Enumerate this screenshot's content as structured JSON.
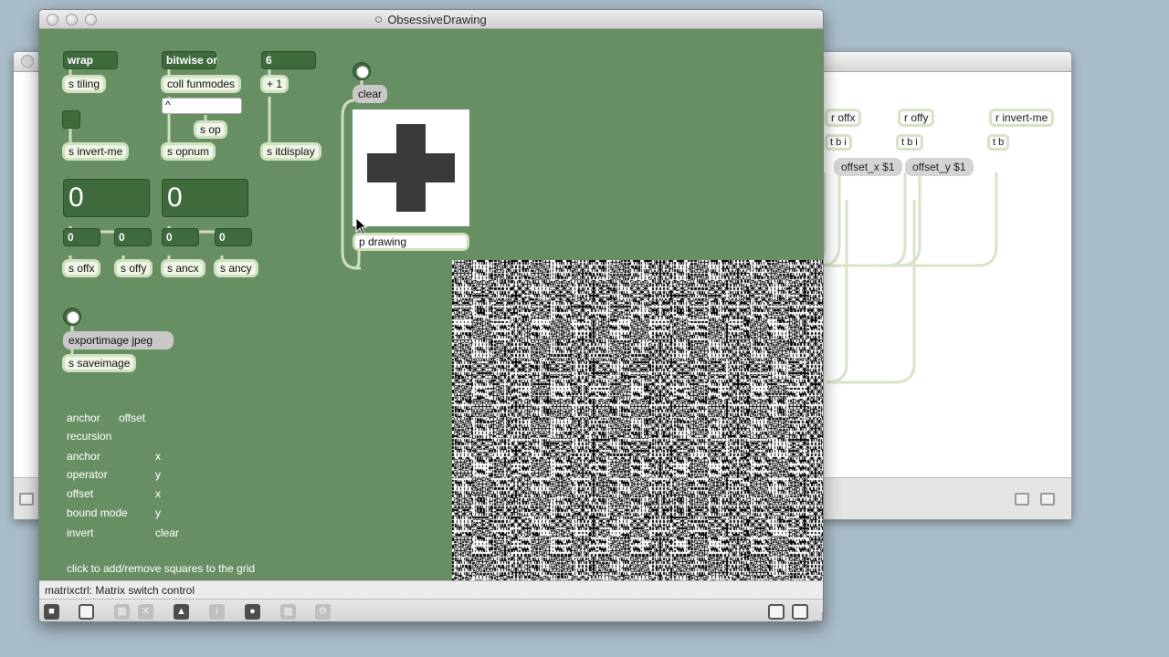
{
  "background_window": {
    "objects": [
      "r offx",
      "r offy",
      "r invert-me"
    ],
    "triggers": [
      "t b i",
      "t b i",
      "t b"
    ],
    "messages": [
      "offset_x $1",
      "offset_y $1"
    ]
  },
  "window": {
    "title": "ObsessiveDrawing"
  },
  "patch": {
    "wrap_menu": "wrap",
    "s_tiling": "s tiling",
    "s_invert_me": "s invert-me",
    "bitwise_menu": "bitwise or",
    "coll_funmodes": "coll funmodes",
    "op_text": "^",
    "s_op": "s op",
    "s_opnum": "s opnum",
    "num_six": "6",
    "plus_one": "+ 1",
    "s_itdisplay": "s itdisplay",
    "clear_msg": "clear",
    "p_drawing": "p drawing",
    "big_num_1": "0",
    "big_num_2": "0",
    "num_a": "0",
    "num_b": "0",
    "num_c": "0",
    "num_d": "0",
    "s_offx": "s offx",
    "s_offy": "s offy",
    "s_ancx": "s ancx",
    "s_ancy": "s ancy",
    "export_msg": "exportimage jpeg",
    "s_saveimage": "s saveimage",
    "comments": {
      "anchor": "anchor",
      "offset": "offset",
      "recursion": "recursion",
      "anchor2": "anchor",
      "x1": "x",
      "operator": "operator",
      "y1": "y",
      "offset2": "offset",
      "x2": "x",
      "bound_mode": "bound mode",
      "y2": "y",
      "invert": "invert",
      "clear": "clear",
      "hint": "click to add/remove squares to the grid"
    }
  },
  "status": {
    "text": "matrixctrl: Matrix switch control"
  },
  "colors": {
    "patch_bg": "#688f64",
    "object_fill": "#eef4e6",
    "number_fill": "#3f6a3c",
    "desktop": "#a9bdc9"
  },
  "icons": [
    "lock-icon",
    "new-object-icon",
    "grid-icon",
    "close-x-icon",
    "presentation-icon",
    "info-icon",
    "toggle-icon",
    "matrix-icon",
    "settings-icon",
    "split-left-icon",
    "split-right-icon"
  ]
}
